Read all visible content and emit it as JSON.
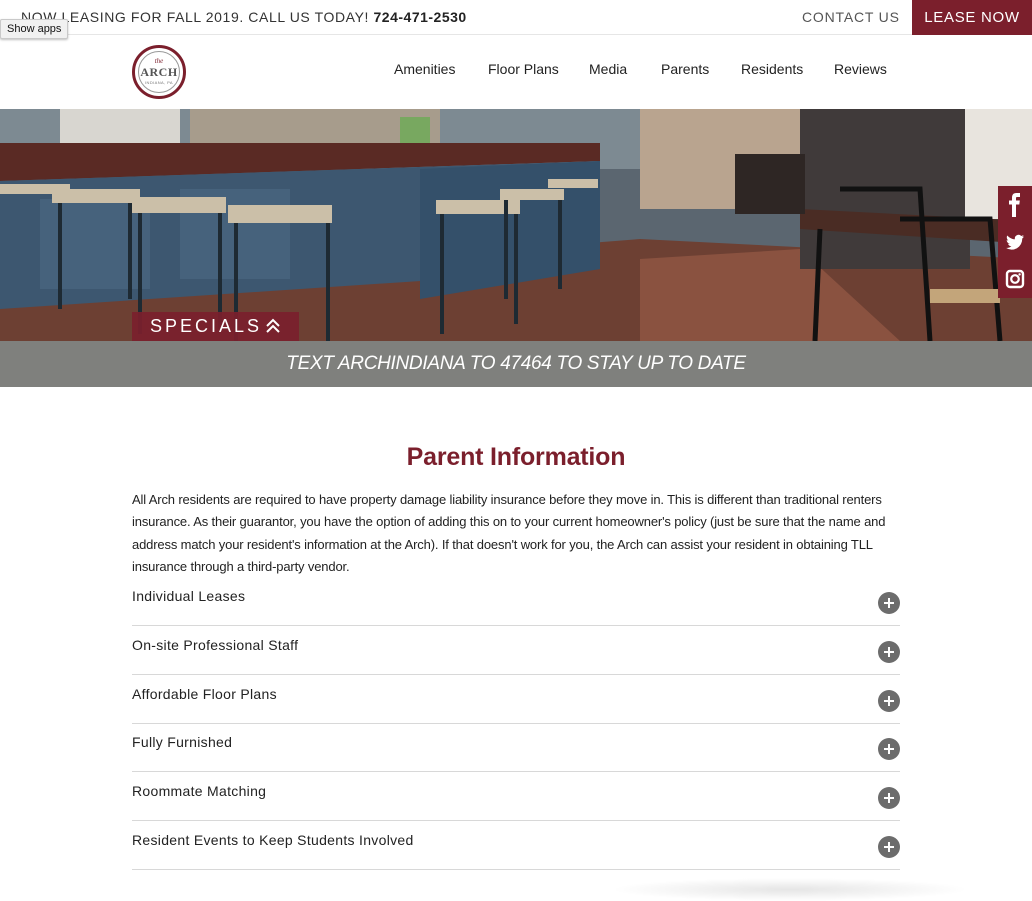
{
  "topbar": {
    "promo_text": "NOW LEASING FOR FALL 2019. CALL US TODAY!",
    "phone": "724-471-2530",
    "contact_label": "CONTACT US",
    "lease_label": "LEASE NOW"
  },
  "browser": {
    "show_apps_label": "Show apps"
  },
  "logo": {
    "top": "the",
    "name": "ARCH",
    "sub": "INDIANA, PA"
  },
  "nav": {
    "items": [
      "Amenities",
      "Floor Plans",
      "Media",
      "Parents",
      "Residents",
      "Reviews"
    ],
    "active": "Parents"
  },
  "hero": {
    "specials_label": "SPECIALS",
    "banner_text": "TEXT ARCHINDIANA TO 47464 TO STAY UP TO DATE"
  },
  "social": {
    "icons": [
      "facebook-icon",
      "twitter-icon",
      "instagram-icon"
    ]
  },
  "content": {
    "title": "Parent Information",
    "paragraph": "All Arch residents are required to have property damage liability insurance before they move in. This is different than traditional renters insurance. As their guarantor, you have the option of adding this on to your current homeowner's policy (just be sure that the name and address match your resident's information at the Arch). If that doesn't work for you, the Arch can assist your resident in obtaining TLL insurance through a third-party vendor.",
    "accordion": [
      "Individual Leases",
      "On-site Professional Staff",
      "Affordable Floor Plans",
      "Fully Furnished",
      "Roommate Matching",
      "Resident Events to Keep Students Involved"
    ]
  },
  "colors": {
    "brand": "#7b1f2c",
    "banner": "#7f807d",
    "accordion_icon": "#6c6c6c"
  }
}
